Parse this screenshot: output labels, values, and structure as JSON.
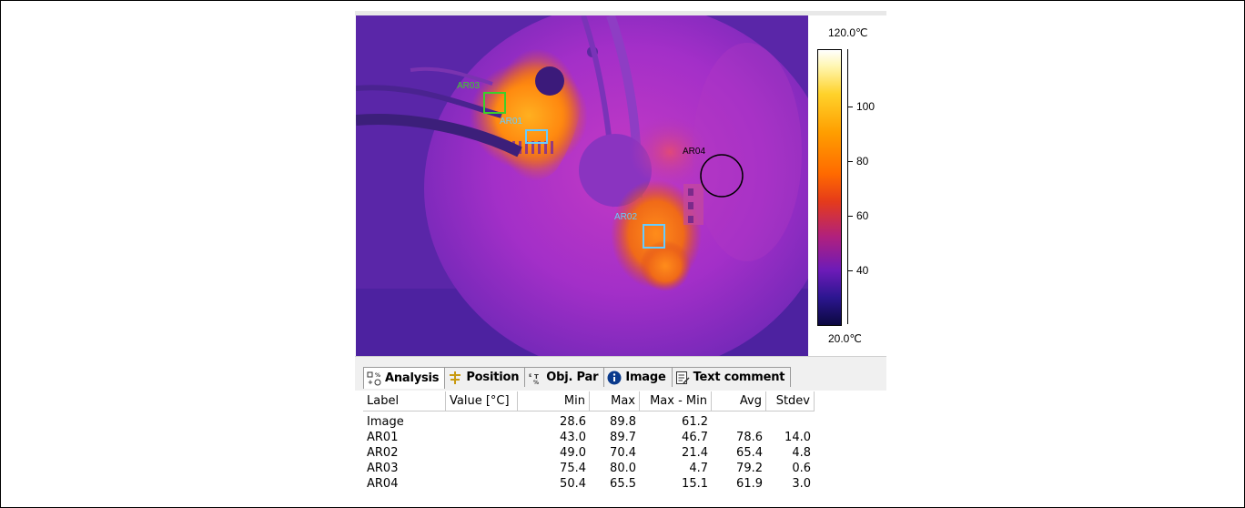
{
  "scale": {
    "max_label": "120.0℃",
    "min_label": "20.0℃",
    "ticks": [
      "100",
      "80",
      "60",
      "40"
    ]
  },
  "rois": [
    {
      "label": "AR03",
      "color": "#3ccf2a"
    },
    {
      "label": "AR01",
      "color": "#66ccff"
    },
    {
      "label": "AR04",
      "color": "#000000"
    },
    {
      "label": "AR02",
      "color": "#66ccff"
    }
  ],
  "tabs": [
    {
      "label": "Analysis",
      "icon": "analysis-icon"
    },
    {
      "label": "Position",
      "icon": "position-icon"
    },
    {
      "label": "Obj. Par",
      "icon": "object-parameter-icon"
    },
    {
      "label": "Image",
      "icon": "info-icon"
    },
    {
      "label": "Text comment",
      "icon": "text-comment-icon"
    }
  ],
  "table": {
    "columns": [
      "Label",
      "Value [°C]",
      "Min",
      "Max",
      "Max - Min",
      "Avg",
      "Stdev"
    ],
    "rows": [
      [
        "Image",
        "",
        "28.6",
        "89.8",
        "61.2",
        "",
        ""
      ],
      [
        "AR01",
        "",
        "43.0",
        "89.7",
        "46.7",
        "78.6",
        "14.0"
      ],
      [
        "AR02",
        "",
        "49.0",
        "70.4",
        "21.4",
        "65.4",
        "4.8"
      ],
      [
        "AR03",
        "",
        "75.4",
        "80.0",
        "4.7",
        "79.2",
        "0.6"
      ],
      [
        "AR04",
        "",
        "50.4",
        "65.5",
        "15.1",
        "61.9",
        "3.0"
      ]
    ]
  }
}
